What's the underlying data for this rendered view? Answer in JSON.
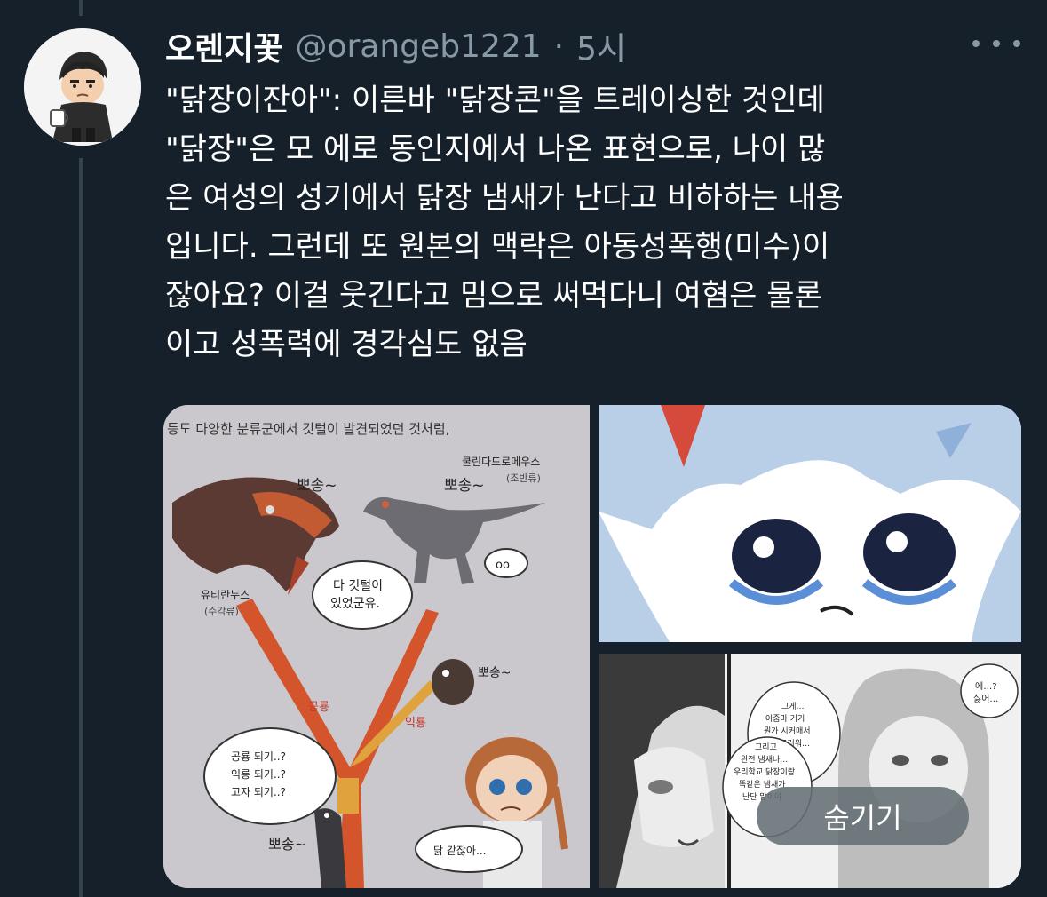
{
  "tweet": {
    "display_name": "오렌지꽃",
    "handle": "@orangeb1221",
    "separator": "·",
    "timestamp": "5시",
    "text_lines": [
      "\"닭장이잔아\": 이른바 \"닭장콘\"을 트레이싱한 것인데",
      "\"닭장\"은 모 에로 동인지에서 나온 표현으로, 나이 많",
      "은 여성의 성기에서 닭장 냄새가 난다고 비하하는 내용",
      "입니다. 그런데 또 원본의 맥락은 아동성폭행(미수)이",
      "잖아요? 이걸 웃긴다고 밈으로 써먹다니 여혐은 물론",
      "이고 성폭력에 경각심도 없음"
    ]
  },
  "media": {
    "image1": {
      "caption_top": "등도 다양한 분류군에서 깃털이 발견되었던 것처럼,",
      "label_utiranus": "유티란누스",
      "label_utiranus_sub": "(수각류)",
      "label_kulinda": "쿨린다드로메우스",
      "label_kulinda_sub": "(조반류)",
      "speech_feathers_1": "다 깃털이",
      "speech_feathers_2": "있었군유.",
      "speech_oo": "oo",
      "label_dinosaur": "공룡",
      "label_pterosaur": "익룡",
      "sfx_1": "뽀송~",
      "sfx_2": "뽀송~",
      "sfx_3": "뽀송~",
      "sfx_4": "뽀송~",
      "thought_1": "공룡 되기..?",
      "thought_2": "익룡 되기..?",
      "thought_3": "고자 되기..?",
      "speech_chicken": "닭 같잖아..."
    },
    "image3": {
      "bubble_a_1": "에…?",
      "bubble_a_2": "싫어…",
      "bubble_b_1": "그게…",
      "bubble_b_2": "아줌마 거기",
      "bubble_b_3": "뭔가 시커매서",
      "bubble_b_4": "징그러워…",
      "bubble_c_1": "그리고",
      "bubble_c_2": "완전 냄새나…",
      "bubble_c_3": "우리학교 닭장이랑",
      "bubble_c_4": "똑같은 냄새가",
      "bubble_c_5": "난단 말이야"
    }
  },
  "hide_button": {
    "label": "숨기기"
  },
  "colors": {
    "background": "#15202b",
    "secondary_text": "#8899a6",
    "thread_line": "#38444d"
  }
}
